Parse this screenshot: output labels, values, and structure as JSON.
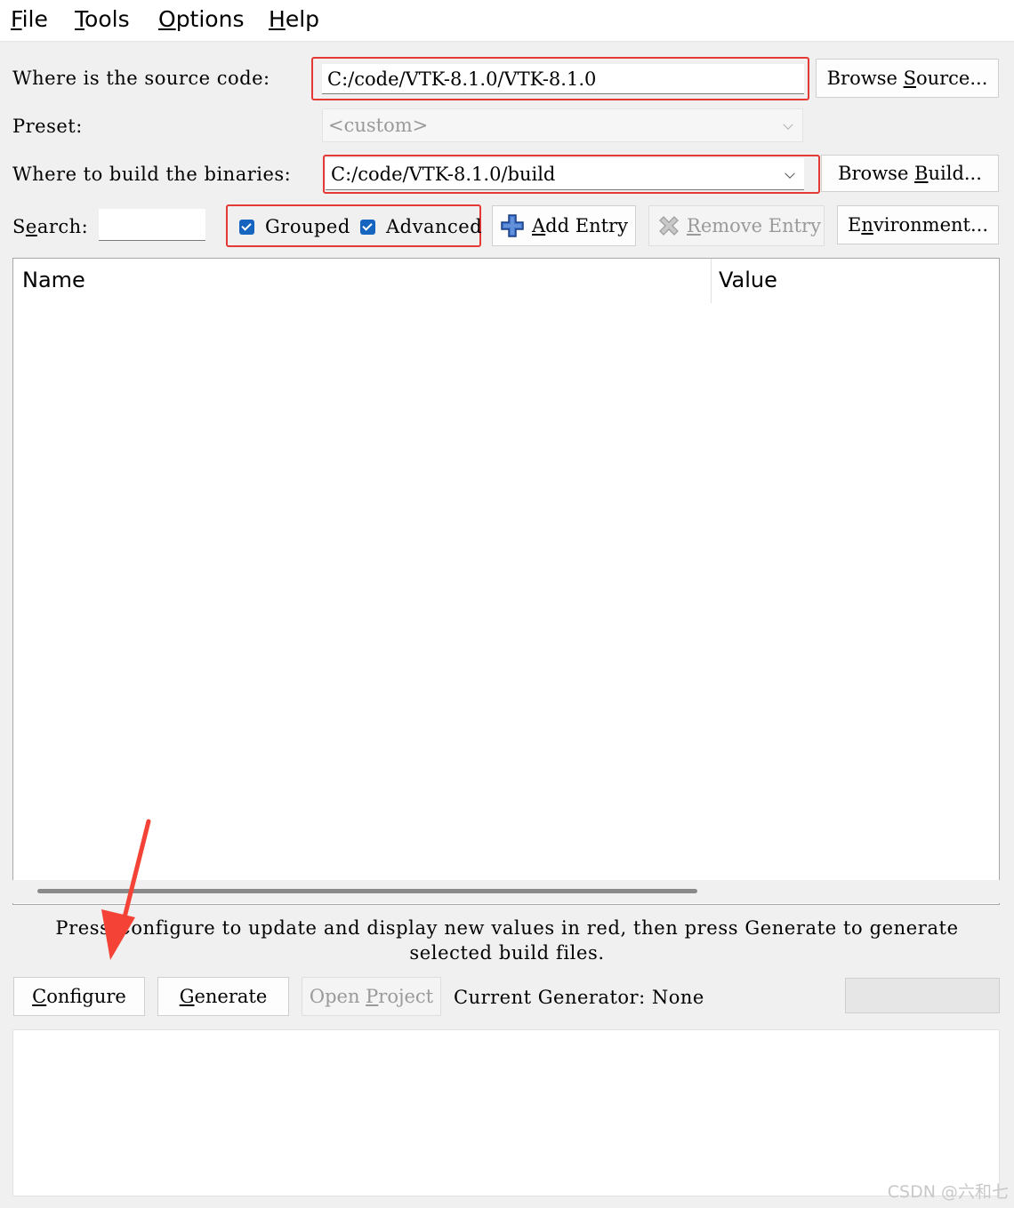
{
  "menu": {
    "file": {
      "mnemonic": "F",
      "rest": "ile"
    },
    "tools": {
      "mnemonic": "T",
      "rest": "ools"
    },
    "options": {
      "mnemonic": "O",
      "rest": "ptions"
    },
    "help": {
      "mnemonic": "H",
      "rest": "elp"
    }
  },
  "source": {
    "label": "Where is the source code:",
    "value": "C:/code/VTK-8.1.0/VTK-8.1.0",
    "browse_pre": "Browse ",
    "browse_mn": "S",
    "browse_post": "ource..."
  },
  "preset": {
    "label": "Preset:",
    "value": "<custom>"
  },
  "build": {
    "label": "Where to build the binaries:",
    "value": "C:/code/VTK-8.1.0/build",
    "browse_pre": "Browse ",
    "browse_mn": "B",
    "browse_post": "uild..."
  },
  "search": {
    "label_pre": "S",
    "label_mn": "e",
    "label_post": "arch:",
    "value": ""
  },
  "options_row": {
    "grouped_label": "Grouped",
    "grouped_checked": true,
    "advanced_label": "Advanced",
    "advanced_checked": true,
    "add_mn": "A",
    "add_post": "dd Entry",
    "remove_mn": "R",
    "remove_post": "emove Entry",
    "env_pre": "E",
    "env_mn": "n",
    "env_post": "vironment..."
  },
  "table": {
    "col_name": "Name",
    "col_value": "Value"
  },
  "hint": {
    "line1": "Press Configure to update and display new values in red, then press Generate to generate",
    "line2": "selected build files."
  },
  "actions": {
    "configure_mn": "C",
    "configure_post": "onfigure",
    "generate_mn": "G",
    "generate_post": "enerate",
    "open_pre": "Open ",
    "open_mn": "P",
    "open_post": "roject",
    "generator_text": "Current Generator: None"
  },
  "watermark": "CSDN @六和七",
  "colors": {
    "highlight": "#e53935",
    "checkbox": "#1565c0",
    "arrow": "#f44336"
  }
}
